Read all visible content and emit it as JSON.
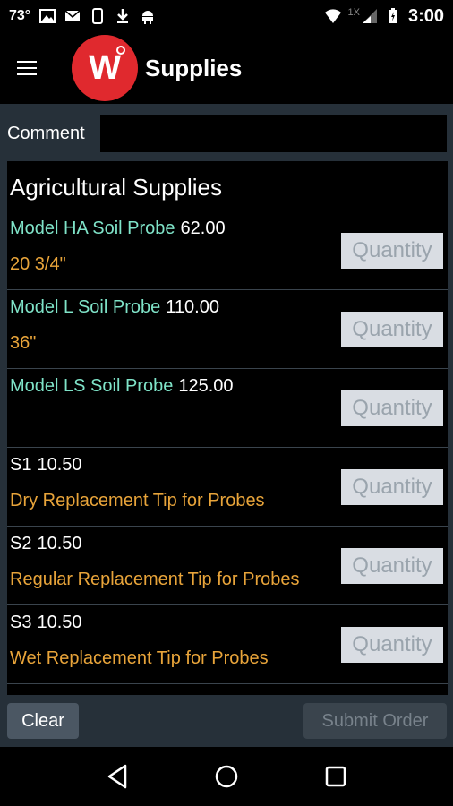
{
  "status": {
    "temp": "73°",
    "lte": "1X",
    "time": "3:00"
  },
  "app_bar": {
    "title": "Supplies",
    "logo_letter": "W"
  },
  "comment": {
    "label": "Comment",
    "value": ""
  },
  "section": {
    "title": "Agricultural Supplies"
  },
  "items": [
    {
      "name": "Model HA Soil Probe",
      "price": "62.00",
      "detail": "20 3/4\"",
      "qty_placeholder": "Quantity"
    },
    {
      "name": "Model L Soil Probe",
      "price": "110.00",
      "detail": "36\"",
      "qty_placeholder": "Quantity"
    },
    {
      "name": "Model LS Soil Probe",
      "price": "125.00",
      "detail": "",
      "qty_placeholder": "Quantity"
    },
    {
      "name": "S1",
      "price": "10.50",
      "detail": "Dry Replacement Tip for Probes",
      "qty_placeholder": "Quantity"
    },
    {
      "name": "S2",
      "price": "10.50",
      "detail": "Regular Replacement Tip for Probes",
      "qty_placeholder": "Quantity"
    },
    {
      "name": "S3",
      "price": "10.50",
      "detail": "Wet Replacement Tip for Probes",
      "qty_placeholder": "Quantity"
    }
  ],
  "buttons": {
    "clear": "Clear",
    "submit": "Submit Order"
  },
  "colors": {
    "logo": "#e0292e",
    "product_name": "#7fe3c8",
    "detail": "#e8a43a",
    "content_bg": "#263039"
  }
}
